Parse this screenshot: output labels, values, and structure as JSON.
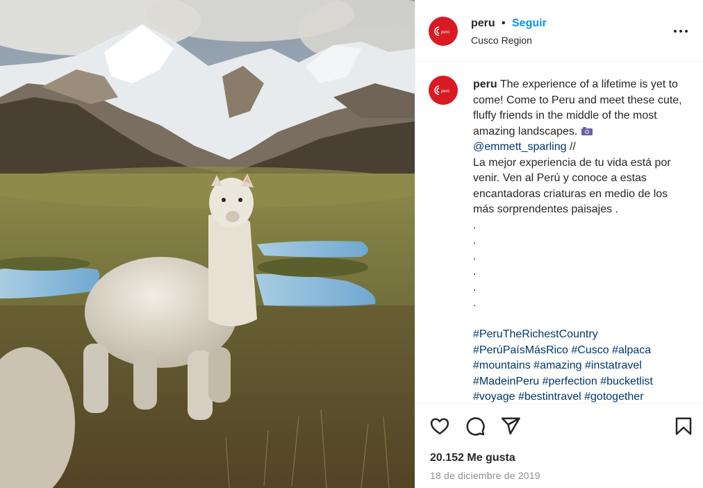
{
  "post": {
    "username": "peru",
    "follow_separator": "•",
    "follow_label": "Seguir",
    "location": "Cusco Region",
    "more_icon": "more-horizontal-icon"
  },
  "caption": {
    "username": "peru",
    "text_en": "The experience of a lifetime is yet to come! Come to Peru and meet these cute, fluffy friends in the middle of the most amazing landscapes.",
    "camera_icon": "camera-icon",
    "mention": "@emmett_sparling",
    "mention_suffix": " //",
    "text_es": "La mejor experiencia de tu vida está por venir. Ven al Perú y conoce a estas encantadoras criaturas en medio de los más sorprendentes paisajes .",
    "dots": [
      ".",
      ".",
      ".",
      ".",
      ".",
      "."
    ],
    "hashtags": [
      "#PeruTheRichestCountry",
      "#PerúPaísMásRico",
      "#Cusco",
      "#alpaca",
      "#mountains",
      "#amazing",
      "#instatravel",
      "#MadeinPeru",
      "#perfection",
      "#bucketlist",
      "#voyage",
      "#bestintravel",
      "#gotogether"
    ]
  },
  "actions": {
    "like_icon": "heart-icon",
    "comment_icon": "comment-bubble-icon",
    "share_icon": "paper-plane-icon",
    "save_icon": "bookmark-icon"
  },
  "stats": {
    "likes": "20.152 Me gusta",
    "date": "18 de diciembre de 2019"
  },
  "colors": {
    "accent_blue": "#0095f6",
    "link_blue": "#00376b",
    "brand_red": "#d91a23",
    "muted_text": "#8e8e8e"
  }
}
